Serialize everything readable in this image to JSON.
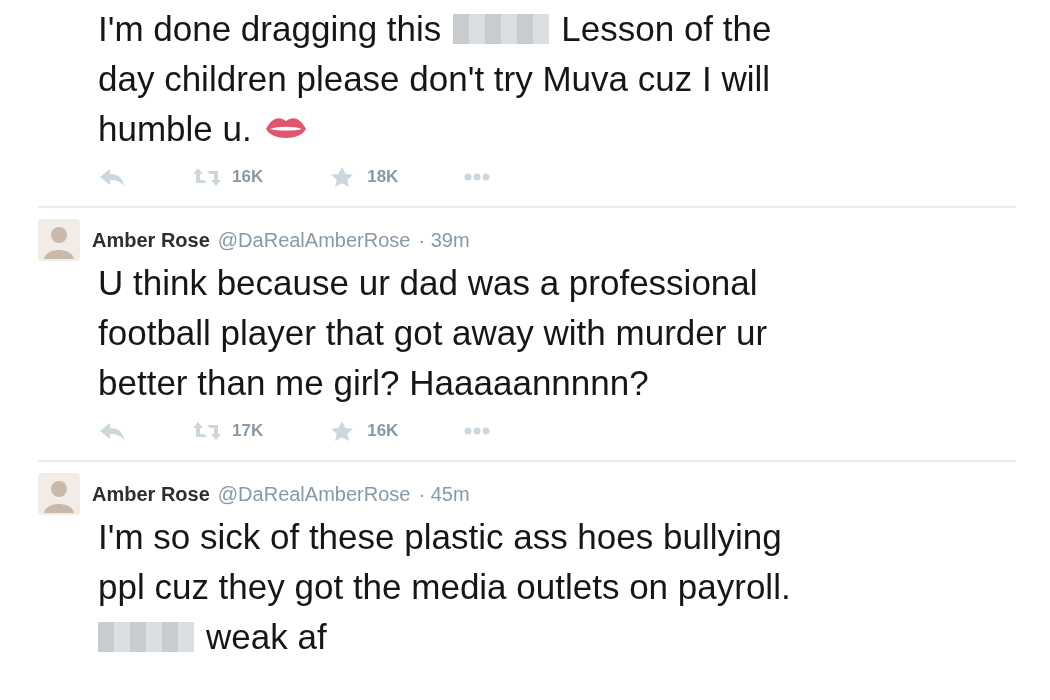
{
  "tweets": [
    {
      "lines": [
        [
          {
            "kind": "text",
            "text": "I'm done dragging this"
          },
          {
            "kind": "censored"
          },
          {
            "kind": "text",
            "text": "Lesson of the"
          }
        ],
        [
          {
            "kind": "text",
            "text": "day children please don't try Muva cuz I will"
          }
        ],
        [
          {
            "kind": "text",
            "text": "humble u."
          },
          {
            "kind": "emoji"
          }
        ]
      ],
      "retweets": "16K",
      "favorites": "18K"
    },
    {
      "name": "Amber Rose",
      "handle": "@DaRealAmberRose",
      "time": "· 39m",
      "lines": [
        [
          {
            "kind": "text",
            "text": "U think because ur dad was a professional"
          }
        ],
        [
          {
            "kind": "text",
            "text": "football player that got away with murder ur"
          }
        ],
        [
          {
            "kind": "text",
            "text": "better than me girl? Haaaaannnnn?"
          }
        ]
      ],
      "retweets": "17K",
      "favorites": "16K"
    },
    {
      "name": "Amber Rose",
      "handle": "@DaRealAmberRose",
      "time": "· 45m",
      "lines": [
        [
          {
            "kind": "text",
            "text": "I'm so sick of these plastic ass hoes bullying"
          }
        ],
        [
          {
            "kind": "text",
            "text": "ppl cuz they got the media outlets on payroll."
          }
        ],
        [
          {
            "kind": "censored"
          },
          {
            "kind": "text",
            "text": "weak af"
          }
        ]
      ]
    }
  ]
}
